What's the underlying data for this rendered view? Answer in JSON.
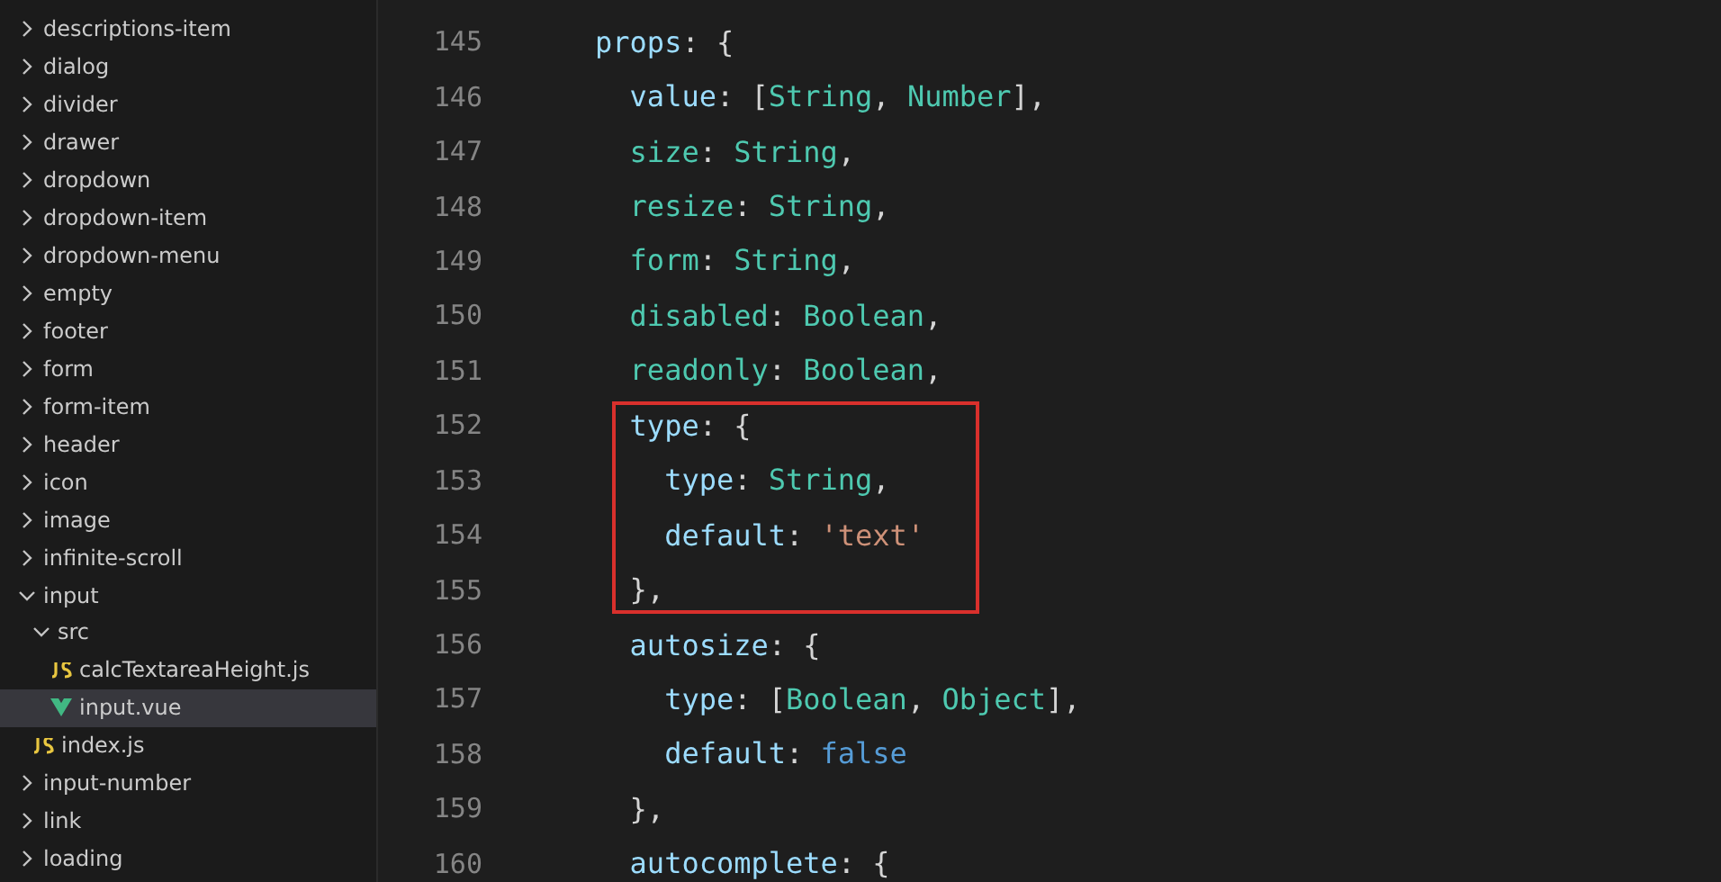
{
  "explorer": {
    "items": [
      {
        "label": "descriptions-item",
        "expanded": false,
        "selected": false
      },
      {
        "label": "dialog",
        "expanded": false,
        "selected": false
      },
      {
        "label": "divider",
        "expanded": false,
        "selected": false
      },
      {
        "label": "drawer",
        "expanded": false,
        "selected": false
      },
      {
        "label": "dropdown",
        "expanded": false,
        "selected": false
      },
      {
        "label": "dropdown-item",
        "expanded": false,
        "selected": false
      },
      {
        "label": "dropdown-menu",
        "expanded": false,
        "selected": false
      },
      {
        "label": "empty",
        "expanded": false,
        "selected": false
      },
      {
        "label": "footer",
        "expanded": false,
        "selected": false
      },
      {
        "label": "form",
        "expanded": false,
        "selected": false
      },
      {
        "label": "form-item",
        "expanded": false,
        "selected": false
      },
      {
        "label": "header",
        "expanded": false,
        "selected": false
      },
      {
        "label": "icon",
        "expanded": false,
        "selected": false
      },
      {
        "label": "image",
        "expanded": false,
        "selected": false
      },
      {
        "label": "infinite-scroll",
        "expanded": false,
        "selected": false
      },
      {
        "label": "input",
        "expanded": true,
        "selected": false,
        "children": [
          {
            "label": "src",
            "expanded": true,
            "selected": false,
            "children": [
              {
                "label": "calcTextareaHeight.js",
                "kind": "js",
                "selected": false
              },
              {
                "label": "input.vue",
                "kind": "vue",
                "selected": true
              }
            ]
          },
          {
            "label": "index.js",
            "kind": "js",
            "selected": false
          }
        ]
      },
      {
        "label": "input-number",
        "expanded": false,
        "selected": false
      },
      {
        "label": "link",
        "expanded": false,
        "selected": false
      },
      {
        "label": "loading",
        "expanded": false,
        "selected": false
      }
    ]
  },
  "editor": {
    "lines": [
      {
        "number": "145",
        "highlighted": false,
        "tokens": [
          {
            "kind": "key",
            "text": "    props"
          },
          {
            "kind": "punct",
            "text": ": {"
          }
        ]
      },
      {
        "number": "146",
        "highlighted": false,
        "tokens": [
          {
            "kind": "key",
            "text": "      value"
          },
          {
            "kind": "punct",
            "text": ": ["
          },
          {
            "kind": "type",
            "text": "String"
          },
          {
            "kind": "punct",
            "text": ", "
          },
          {
            "kind": "type",
            "text": "Number"
          },
          {
            "kind": "punct",
            "text": "],"
          }
        ]
      },
      {
        "number": "147",
        "highlighted": false,
        "tokens": [
          {
            "kind": "prop",
            "text": "      size"
          },
          {
            "kind": "punct",
            "text": ": "
          },
          {
            "kind": "type",
            "text": "String"
          },
          {
            "kind": "punct",
            "text": ","
          }
        ]
      },
      {
        "number": "148",
        "highlighted": false,
        "tokens": [
          {
            "kind": "prop",
            "text": "      resize"
          },
          {
            "kind": "punct",
            "text": ": "
          },
          {
            "kind": "type",
            "text": "String"
          },
          {
            "kind": "punct",
            "text": ","
          }
        ]
      },
      {
        "number": "149",
        "highlighted": false,
        "tokens": [
          {
            "kind": "prop",
            "text": "      form"
          },
          {
            "kind": "punct",
            "text": ": "
          },
          {
            "kind": "type",
            "text": "String"
          },
          {
            "kind": "punct",
            "text": ","
          }
        ]
      },
      {
        "number": "150",
        "highlighted": false,
        "tokens": [
          {
            "kind": "prop",
            "text": "      disabled"
          },
          {
            "kind": "punct",
            "text": ": "
          },
          {
            "kind": "type",
            "text": "Boolean"
          },
          {
            "kind": "punct",
            "text": ","
          }
        ]
      },
      {
        "number": "151",
        "highlighted": false,
        "tokens": [
          {
            "kind": "prop",
            "text": "      readonly"
          },
          {
            "kind": "punct",
            "text": ": "
          },
          {
            "kind": "type",
            "text": "Boolean"
          },
          {
            "kind": "punct",
            "text": ","
          }
        ]
      },
      {
        "number": "152",
        "highlighted": true,
        "tokens": [
          {
            "kind": "key",
            "text": "      type"
          },
          {
            "kind": "punct",
            "text": ": {"
          }
        ]
      },
      {
        "number": "153",
        "highlighted": true,
        "tokens": [
          {
            "kind": "key",
            "text": "        type"
          },
          {
            "kind": "punct",
            "text": ": "
          },
          {
            "kind": "type",
            "text": "String"
          },
          {
            "kind": "punct",
            "text": ","
          }
        ]
      },
      {
        "number": "154",
        "highlighted": true,
        "tokens": [
          {
            "kind": "key",
            "text": "        default"
          },
          {
            "kind": "punct",
            "text": ": "
          },
          {
            "kind": "string",
            "text": "'text'"
          }
        ]
      },
      {
        "number": "155",
        "highlighted": true,
        "tokens": [
          {
            "kind": "punct",
            "text": "      },"
          }
        ]
      },
      {
        "number": "156",
        "highlighted": false,
        "tokens": [
          {
            "kind": "key",
            "text": "      autosize"
          },
          {
            "kind": "punct",
            "text": ": {"
          }
        ]
      },
      {
        "number": "157",
        "highlighted": false,
        "tokens": [
          {
            "kind": "key",
            "text": "        type"
          },
          {
            "kind": "punct",
            "text": ": ["
          },
          {
            "kind": "type",
            "text": "Boolean"
          },
          {
            "kind": "punct",
            "text": ", "
          },
          {
            "kind": "type",
            "text": "Object"
          },
          {
            "kind": "punct",
            "text": "],"
          }
        ]
      },
      {
        "number": "158",
        "highlighted": false,
        "tokens": [
          {
            "kind": "key",
            "text": "        default"
          },
          {
            "kind": "punct",
            "text": ": "
          },
          {
            "kind": "keyword",
            "text": "false"
          }
        ]
      },
      {
        "number": "159",
        "highlighted": false,
        "tokens": [
          {
            "kind": "punct",
            "text": "      },"
          }
        ]
      },
      {
        "number": "160",
        "highlighted": false,
        "tokens": [
          {
            "kind": "key",
            "text": "      autocomplete"
          },
          {
            "kind": "punct",
            "text": ": {"
          }
        ]
      }
    ]
  }
}
